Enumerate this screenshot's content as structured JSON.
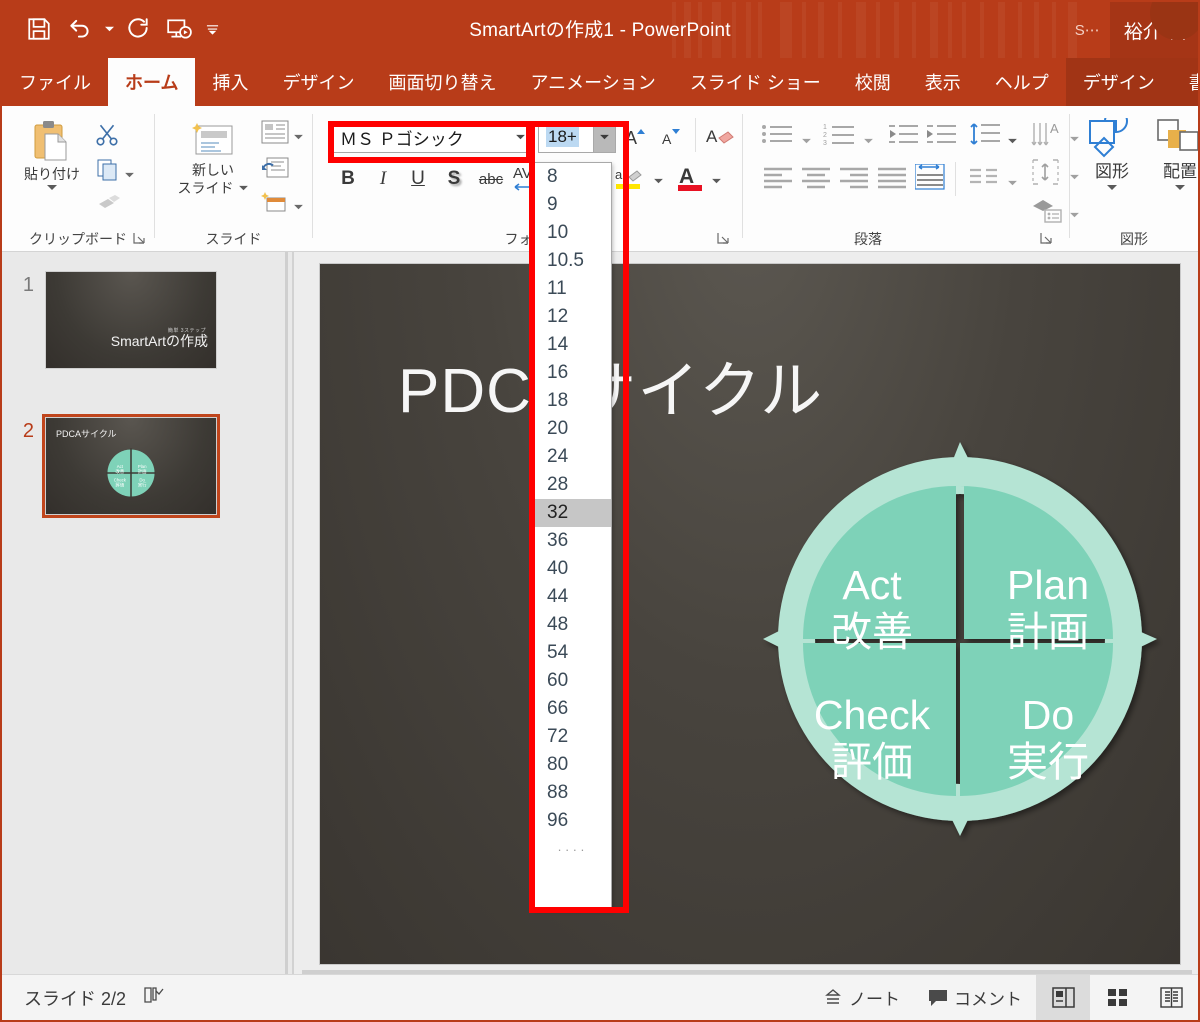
{
  "app": {
    "title": "SmartArtの作成1  -  PowerPoint",
    "share_label": "S⋯",
    "account_name": "裕介 相"
  },
  "quick_access": [
    {
      "name": "save-icon",
      "label": "上書き保存"
    },
    {
      "name": "undo-icon",
      "label": "元に戻す"
    },
    {
      "name": "redo-icon",
      "label": "やり直し"
    },
    {
      "name": "slideshow-icon",
      "label": "先頭から開始"
    },
    {
      "name": "customize-qat-icon",
      "label": "クイック アクセス ツール バーのユーザー設定"
    }
  ],
  "tabs": [
    {
      "label": "ファイル",
      "active": false,
      "contextual": false
    },
    {
      "label": "ホーム",
      "active": true,
      "contextual": false
    },
    {
      "label": "挿入",
      "active": false,
      "contextual": false
    },
    {
      "label": "デザイン",
      "active": false,
      "contextual": false
    },
    {
      "label": "画面切り替え",
      "active": false,
      "contextual": false
    },
    {
      "label": "アニメーション",
      "active": false,
      "contextual": false
    },
    {
      "label": "スライド ショー",
      "active": false,
      "contextual": false
    },
    {
      "label": "校閲",
      "active": false,
      "contextual": false
    },
    {
      "label": "表示",
      "active": false,
      "contextual": false
    },
    {
      "label": "ヘルプ",
      "active": false,
      "contextual": false
    },
    {
      "label": "デザイン",
      "active": false,
      "contextual": true
    },
    {
      "label": "書",
      "active": false,
      "contextual": true
    }
  ],
  "ribbon": {
    "groups": {
      "clipboard": {
        "label": "クリップボード"
      },
      "slide": {
        "label": "スライド"
      },
      "font": {
        "label": "フォン"
      },
      "paragraph": {
        "label": "段落"
      },
      "drawing": {
        "label": "図形"
      }
    },
    "clipboard": {
      "paste_label": "貼り付け",
      "cut_label": "切り取り",
      "copy_label": "コピー",
      "format_painter_label": "書式のコピー/貼り付け"
    },
    "slide": {
      "new_slide_label": "新しい\nスライド",
      "new_slide_line1": "新しい",
      "new_slide_line2": "スライド",
      "layout_label": "レイアウト",
      "reset_label": "リセット",
      "section_label": "セクション"
    },
    "font": {
      "font_name_value": "ＭＳ Ｐゴシック",
      "font_size_value": "18+",
      "grow_font_label": "A",
      "shrink_font_label": "A",
      "clear_format_label": "すべての書式をクリア",
      "bold_label": "B",
      "italic_label": "I",
      "underline_label": "U",
      "shadow_label": "S",
      "strikethrough_label": "abc",
      "character_spacing_label": "AV",
      "highlight_label": "蛍光ペンの色",
      "font_color_label": "A"
    },
    "paragraph": {
      "bullets_label": "箇条書き",
      "numbering_label": "段落番号",
      "decrease_indent_label": "インデントを減らす",
      "increase_indent_label": "インデントを増やす",
      "align_left_label": "左揃え",
      "align_center_label": "中央揃え",
      "align_right_label": "右揃え",
      "justify_label": "両端揃え",
      "columns_label": "段組み",
      "line_spacing_label": "行間",
      "text_direction_label": "文字列の方向",
      "align_text_label": "文字の配置",
      "smartart_label": "SmartArt に変換"
    },
    "drawing": {
      "shapes_label": "図形",
      "arrange_label": "配置"
    }
  },
  "font_size_dropdown": {
    "selected": "32",
    "current_text": "18+",
    "options": [
      "8",
      "9",
      "10",
      "10.5",
      "11",
      "12",
      "14",
      "16",
      "18",
      "20",
      "24",
      "28",
      "32",
      "36",
      "40",
      "44",
      "48",
      "54",
      "60",
      "66",
      "72",
      "80",
      "88",
      "96"
    ],
    "more_indicator": "...."
  },
  "annotations": {
    "highlight_color": "#ff0000",
    "boxes": [
      "font-name-box",
      "font-size-dropdown-box"
    ]
  },
  "thumbnails": [
    {
      "number": "1",
      "active": false,
      "title": "SmartArtの作成",
      "subtitle": "簡単 3ステップ"
    },
    {
      "number": "2",
      "active": true,
      "title": "PDCAサイクル"
    }
  ],
  "slide": {
    "title": "PDCAサイクル",
    "diagram": {
      "name": "pdca-cycle",
      "fill_color": "#7ed2b8",
      "arrow_color": "#b5e4d4",
      "quadrants": [
        {
          "position": "top-right",
          "en": "Plan",
          "ja": "計画"
        },
        {
          "position": "bottom-right",
          "en": "Do",
          "ja": "実行"
        },
        {
          "position": "bottom-left",
          "en": "Check",
          "ja": "評価"
        },
        {
          "position": "top-left",
          "en": "Act",
          "ja": "改善"
        }
      ]
    }
  },
  "statusbar": {
    "slide_counter": "スライド 2/2",
    "spellcheck_label": "アクセシビリティ",
    "notes_label": "ノート",
    "comments_label": "コメント",
    "views": [
      {
        "name": "normal-view",
        "active": true
      },
      {
        "name": "slide-sorter-view",
        "active": false
      },
      {
        "name": "reading-view",
        "active": false
      }
    ]
  }
}
